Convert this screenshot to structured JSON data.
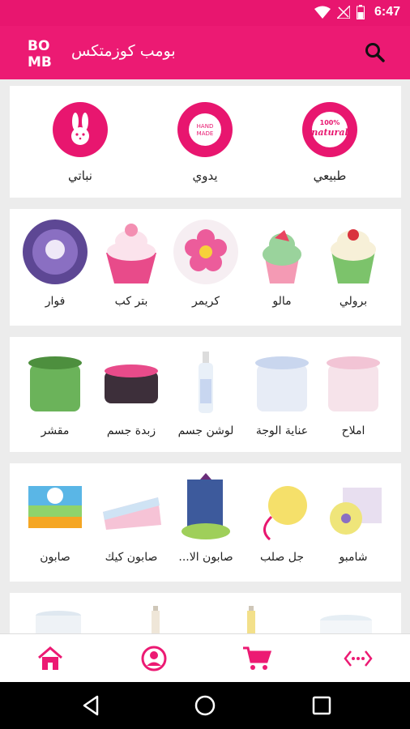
{
  "status": {
    "time": "6:47",
    "icons": [
      "wifi-icon",
      "no-signal-icon",
      "battery-icon"
    ]
  },
  "app": {
    "title": "بومب كوزمتكس",
    "logo_text_top": "BO",
    "logo_text_bottom": "MB",
    "brand_color": "#ec1a73"
  },
  "categories": [
    {
      "label": "طبيعي",
      "icon": "natural-badge-icon",
      "badge_top": "100%",
      "badge_main": "natural"
    },
    {
      "label": "يدوي",
      "icon": "handmade-badge-icon",
      "badge_top": "HAND",
      "badge_main": "MADE"
    },
    {
      "label": "نباتي",
      "icon": "rabbit-icon"
    }
  ],
  "row1": [
    {
      "label": "برولي",
      "icon": "cupcake-green-icon"
    },
    {
      "label": "مالو",
      "icon": "cupcake-mint-icon"
    },
    {
      "label": "كريمر",
      "icon": "bath-bomb-flower-icon"
    },
    {
      "label": "بتر كب",
      "icon": "cupcake-pink-icon"
    },
    {
      "label": "فوار",
      "icon": "bath-bomb-purple-icon"
    }
  ],
  "row2": [
    {
      "label": "املاح",
      "icon": "jar-pink-icon"
    },
    {
      "label": "عناية الوجة",
      "icon": "jar-blue-icon"
    },
    {
      "label": "لوشن جسم",
      "icon": "lotion-bottle-icon"
    },
    {
      "label": "زبدة جسم",
      "icon": "jar-dark-icon"
    },
    {
      "label": "مقشر",
      "icon": "jar-green-icon"
    }
  ],
  "row3": [
    {
      "label": "شامبو",
      "icon": "shampoo-bar-icon"
    },
    {
      "label": "جل صلب",
      "icon": "solid-gel-icon"
    },
    {
      "label": "صابون الا...",
      "icon": "gift-soap-icon"
    },
    {
      "label": "صابون كيك",
      "icon": "cake-soap-icon"
    },
    {
      "label": "صابون",
      "icon": "soap-bar-icon"
    }
  ],
  "bottom_nav": [
    "home-icon",
    "user-icon",
    "cart-icon",
    "more-icon"
  ]
}
